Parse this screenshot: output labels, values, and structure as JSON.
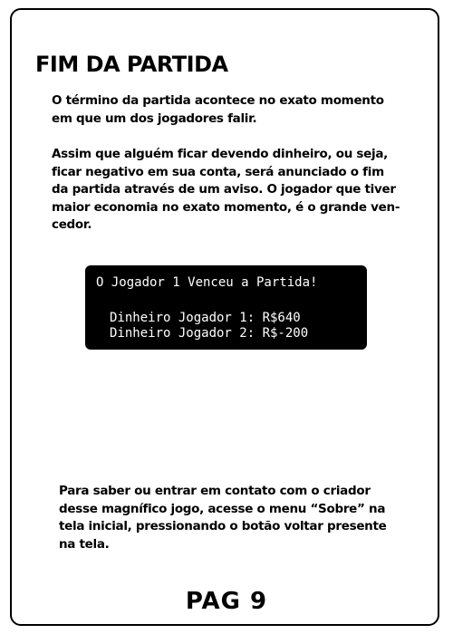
{
  "title": "FIM DA PARTIDA",
  "paragraph1": [
    "O término da partida acontece no exato momento",
    "em que um dos jogadores falir."
  ],
  "paragraph2": [
    "Assim que alguém ficar devendo dinheiro, ou seja,",
    "ficar negativo em sua conta, será anunciado o fim",
    "da partida através de um aviso. O jogador que tiver",
    "maior economia no exato momento, é o grande ven-",
    "cedor."
  ],
  "game_message": {
    "headline": "O Jogador 1 Venceu a Partida!",
    "player1_money": "Dinheiro Jogador 1: R$640",
    "player2_money": "Dinheiro Jogador 2: R$-200"
  },
  "paragraph3": [
    "Para saber ou entrar em contato com o criador",
    "desse magnífico jogo, acesse o menu “Sobre” na",
    "tela inicial, pressionando o botão voltar presente",
    "na tela."
  ],
  "page_number": "PAG 9"
}
